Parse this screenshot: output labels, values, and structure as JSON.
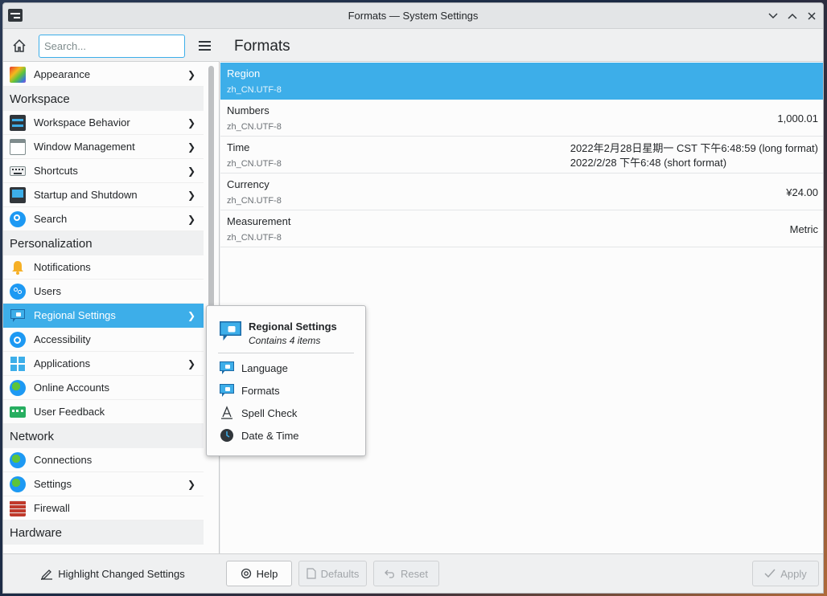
{
  "window": {
    "title": "Formats — System Settings"
  },
  "search": {
    "placeholder": "Search..."
  },
  "sidebar": {
    "items": [
      {
        "label": "Appearance",
        "chevron": true
      },
      {
        "section": "Workspace"
      },
      {
        "label": "Workspace Behavior",
        "chevron": true
      },
      {
        "label": "Window Management",
        "chevron": true
      },
      {
        "label": "Shortcuts",
        "chevron": true
      },
      {
        "label": "Startup and Shutdown",
        "chevron": true
      },
      {
        "label": "Search",
        "chevron": true
      },
      {
        "section": "Personalization"
      },
      {
        "label": "Notifications",
        "chevron": false
      },
      {
        "label": "Users",
        "chevron": false
      },
      {
        "label": "Regional Settings",
        "chevron": true,
        "active": true
      },
      {
        "label": "Accessibility",
        "chevron": false
      },
      {
        "label": "Applications",
        "chevron": true
      },
      {
        "label": "Online Accounts",
        "chevron": false
      },
      {
        "label": "User Feedback",
        "chevron": false
      },
      {
        "section": "Network"
      },
      {
        "label": "Connections",
        "chevron": false
      },
      {
        "label": "Settings",
        "chevron": true
      },
      {
        "label": "Firewall",
        "chevron": false
      },
      {
        "section": "Hardware"
      }
    ]
  },
  "main": {
    "title": "Formats",
    "rows": [
      {
        "name": "Region",
        "locale": "zh_CN.UTF-8",
        "value": "",
        "selected": true
      },
      {
        "name": "Numbers",
        "locale": "zh_CN.UTF-8",
        "value": "1,000.01"
      },
      {
        "name": "Time",
        "locale": "zh_CN.UTF-8",
        "value_long": "2022年2月28日星期一 CST 下午6:48:59 (long format)",
        "value_short": "2022/2/28 下午6:48 (short format)"
      },
      {
        "name": "Currency",
        "locale": "zh_CN.UTF-8",
        "value": "¥24.00"
      },
      {
        "name": "Measurement",
        "locale": "zh_CN.UTF-8",
        "value": "Metric"
      }
    ]
  },
  "popup": {
    "title": "Regional Settings",
    "subtitle": "Contains 4 items",
    "items": [
      "Language",
      "Formats",
      "Spell Check",
      "Date & Time"
    ]
  },
  "footer": {
    "highlight_label": "Highlight Changed Settings",
    "help_label": "Help",
    "defaults_label": "Defaults",
    "reset_label": "Reset",
    "apply_label": "Apply"
  },
  "colors": {
    "accent": "#3daee9",
    "window_bg": "#eff0f1",
    "view_bg": "#fcfcfc"
  }
}
